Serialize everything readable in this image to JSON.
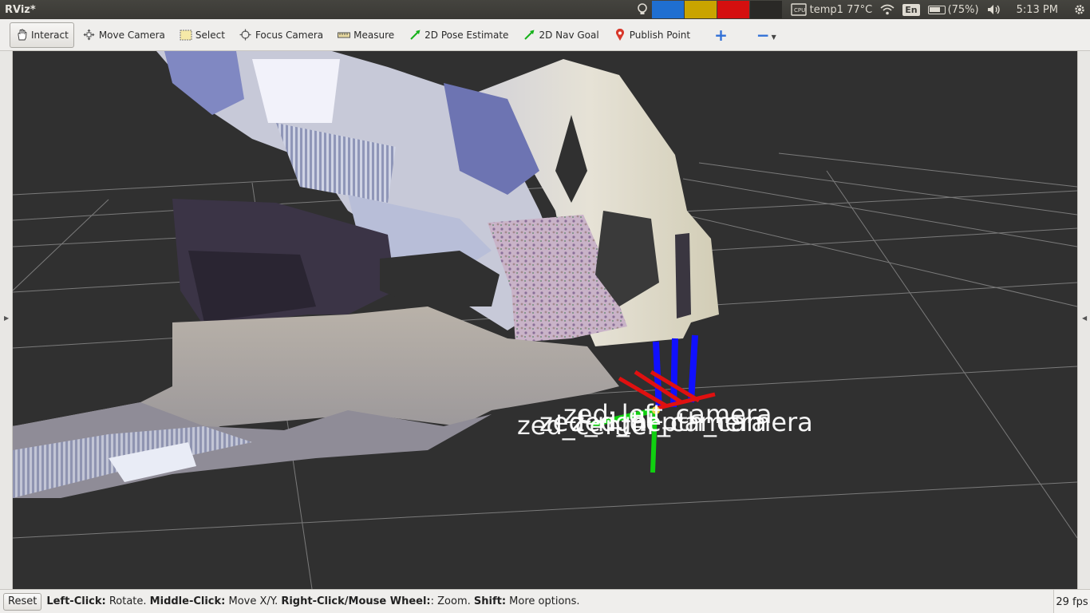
{
  "window": {
    "title": "RViz*"
  },
  "panel": {
    "temp_label": "temp1 77°C",
    "keyboard_layout": "En",
    "battery": "(75%)",
    "clock": "5:13 PM",
    "sysmon_colors": [
      "#1f6fd1",
      "#c9a400",
      "#d40f0f",
      "#2a2926"
    ]
  },
  "toolbar": {
    "items": [
      {
        "label": "Interact",
        "icon": "hand-icon",
        "active": true
      },
      {
        "label": "Move Camera",
        "icon": "move-camera-icon"
      },
      {
        "label": "Select",
        "icon": "select-box-icon"
      },
      {
        "label": "Focus Camera",
        "icon": "focus-camera-icon"
      },
      {
        "label": "Measure",
        "icon": "ruler-icon"
      },
      {
        "label": "2D Pose Estimate",
        "icon": "pose-arrow-icon"
      },
      {
        "label": "2D Nav Goal",
        "icon": "nav-arrow-icon"
      },
      {
        "label": "Publish Point",
        "icon": "map-pin-icon"
      }
    ],
    "add_tool": "+",
    "remove_tool": "−"
  },
  "viewport": {
    "background": "#303030",
    "frame_labels": [
      "zed_left_camera",
      "zed_right_camera",
      "zed_center",
      "zed_depth_camera"
    ]
  },
  "status": {
    "reset_label": "Reset",
    "help_parts": [
      {
        "key": "Left-Click:",
        "text": " Rotate. "
      },
      {
        "key": "Middle-Click:",
        "text": " Move X/Y. "
      },
      {
        "key": "Right-Click/Mouse Wheel:",
        "text": ": Zoom. "
      },
      {
        "key": "Shift:",
        "text": " More options."
      }
    ],
    "fps": "29 fps"
  }
}
